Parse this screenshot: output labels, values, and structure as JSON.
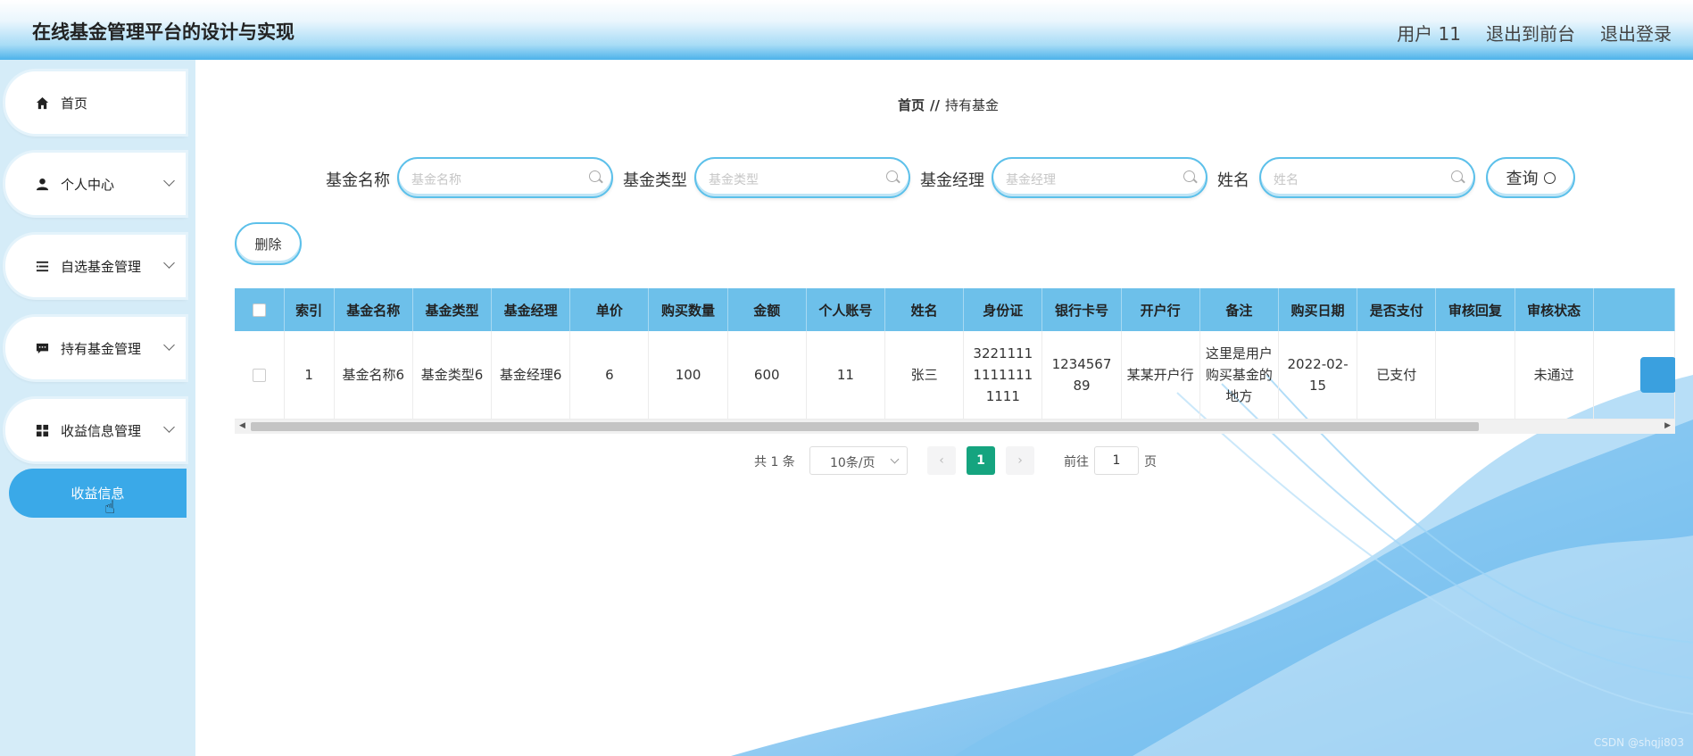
{
  "header": {
    "title": "在线基金管理平台的设计与实现",
    "user": "用户 11",
    "exit_front": "退出到前台",
    "logout": "退出登录"
  },
  "sidebar": {
    "items": [
      {
        "label": "首页",
        "icon": "home-icon"
      },
      {
        "label": "个人中心",
        "icon": "user-icon"
      },
      {
        "label": "自选基金管理",
        "icon": "list-icon"
      },
      {
        "label": "持有基金管理",
        "icon": "message-icon"
      },
      {
        "label": "收益信息管理",
        "icon": "grid-icon"
      }
    ],
    "active_sub": "收益信息"
  },
  "breadcrumb": {
    "home": "首页",
    "sep": "//",
    "current": "持有基金"
  },
  "search": {
    "fund_name_label": "基金名称",
    "fund_name_placeholder": "基金名称",
    "fund_type_label": "基金类型",
    "fund_type_placeholder": "基金类型",
    "fund_manager_label": "基金经理",
    "fund_manager_placeholder": "基金经理",
    "name_label": "姓名",
    "name_placeholder": "姓名",
    "query_label": "查询"
  },
  "toolbar": {
    "delete_label": "删除"
  },
  "table": {
    "headers": [
      "索引",
      "基金名称",
      "基金类型",
      "基金经理",
      "单价",
      "购买数量",
      "金额",
      "个人账号",
      "姓名",
      "身份证",
      "银行卡号",
      "开户行",
      "备注",
      "购买日期",
      "是否支付",
      "审核回复",
      "审核状态"
    ],
    "rows": [
      [
        "1",
        "基金名称6",
        "基金类型6",
        "基金经理6",
        "6",
        "100",
        "600",
        "11",
        "张三",
        "322111111111111111",
        "123456789",
        "某某开户行",
        "这里是用户购买基金的地方",
        "2022-02-15",
        "已支付",
        "",
        "未通过"
      ]
    ]
  },
  "pager": {
    "total": "共 1 条",
    "page_size": "10条/页",
    "current": "1",
    "goto_label": "前往",
    "goto_value": "1",
    "page_label": "页"
  },
  "watermark": "CSDN @shqji803",
  "colors": {
    "accent": "#3aa9e8",
    "header_th": "#6dc0ea",
    "pager_active": "#15a47f",
    "sidebar_bg": "#d5ecf8"
  }
}
